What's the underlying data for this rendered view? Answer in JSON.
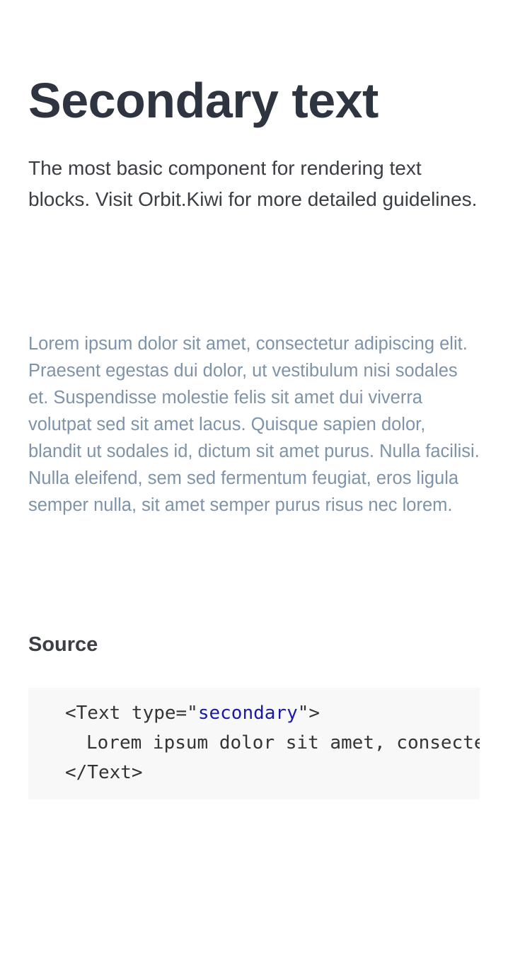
{
  "page": {
    "title": "Secondary text",
    "intro": "The most basic component for rendering text blocks. Visit Orbit.Kiwi for more detailed guidelines."
  },
  "example": {
    "secondary_text": "Lorem ipsum dolor sit amet, consectetur adipiscing elit. Praesent egestas dui dolor, ut vestibulum nisi sodales et. Suspendisse molestie felis sit amet dui viverra volutpat sed sit amet lacus. Quisque sapien dolor, blandit ut sodales id, dictum sit amet purus. Nulla facilisi. Nulla eleifend, sem sed fermentum feugiat, eros ligula semper nulla, sit amet semper purus risus nec lorem.",
    "color": "#7e93a8"
  },
  "source": {
    "heading": "Source",
    "code": {
      "line1_open": "<Text type=\"",
      "line1_value": "secondary",
      "line1_close": "\">",
      "line2": "Lorem ipsum dolor sit amet, consectetur adipiscing elit.",
      "line3": "</Text>"
    },
    "value_color": "#1a1aa6",
    "background": "#f8f8f8"
  }
}
